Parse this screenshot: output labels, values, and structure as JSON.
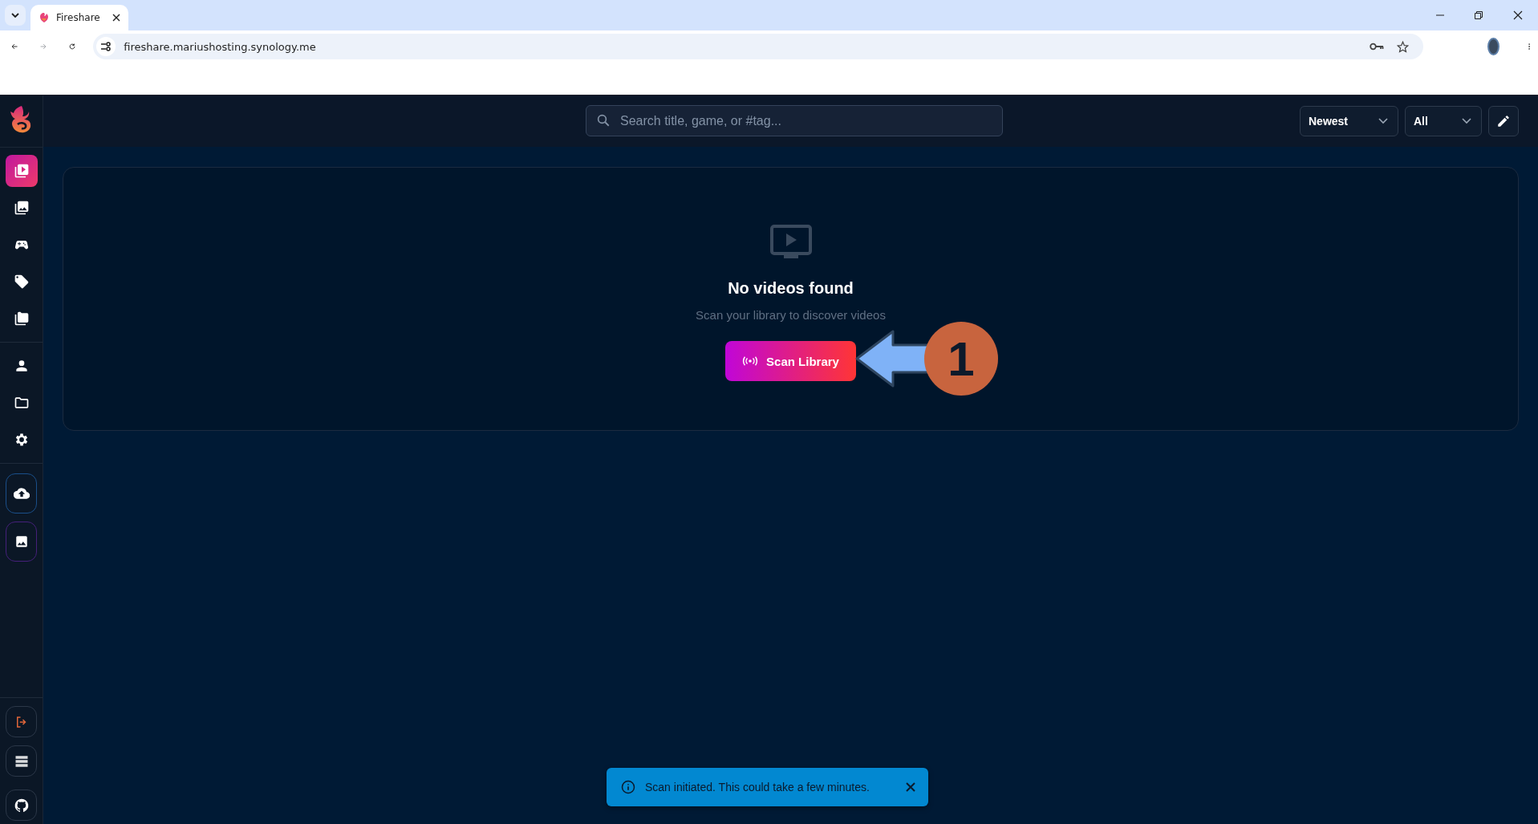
{
  "browser": {
    "tab": {
      "title": "Fireshare"
    },
    "url": "fireshare.mariushosting.synology.me"
  },
  "sidebar": {
    "sections": [
      {
        "items": [
          {
            "kind": "plain",
            "selected": true
          },
          {
            "kind": "plain",
            "selected": false
          },
          {
            "kind": "plain",
            "selected": false
          },
          {
            "kind": "plain",
            "selected": false
          },
          {
            "kind": "plain",
            "selected": false
          }
        ]
      },
      {
        "items": [
          {
            "kind": "plain",
            "selected": false
          },
          {
            "kind": "plain",
            "selected": false
          },
          {
            "kind": "plain",
            "selected": false
          }
        ]
      },
      {
        "items": [
          {
            "kind": "boxed",
            "selected": false
          },
          {
            "kind": "boxed",
            "selected": false
          }
        ]
      }
    ],
    "footer": [
      {
        "kind": "boxed"
      },
      {
        "kind": "boxed"
      },
      {
        "kind": "boxed"
      }
    ]
  },
  "topbar": {
    "search": {
      "placeholder": "Search title, game, or #tag..."
    },
    "sort": "Newest",
    "filter": "All"
  },
  "empty_state": {
    "title": "No videos found",
    "subtitle": "Scan your library to discover videos",
    "button": "Scan Library"
  },
  "annotation": {
    "step": "1"
  },
  "toast": {
    "message": "Scan initiated. This could take a few minutes."
  }
}
